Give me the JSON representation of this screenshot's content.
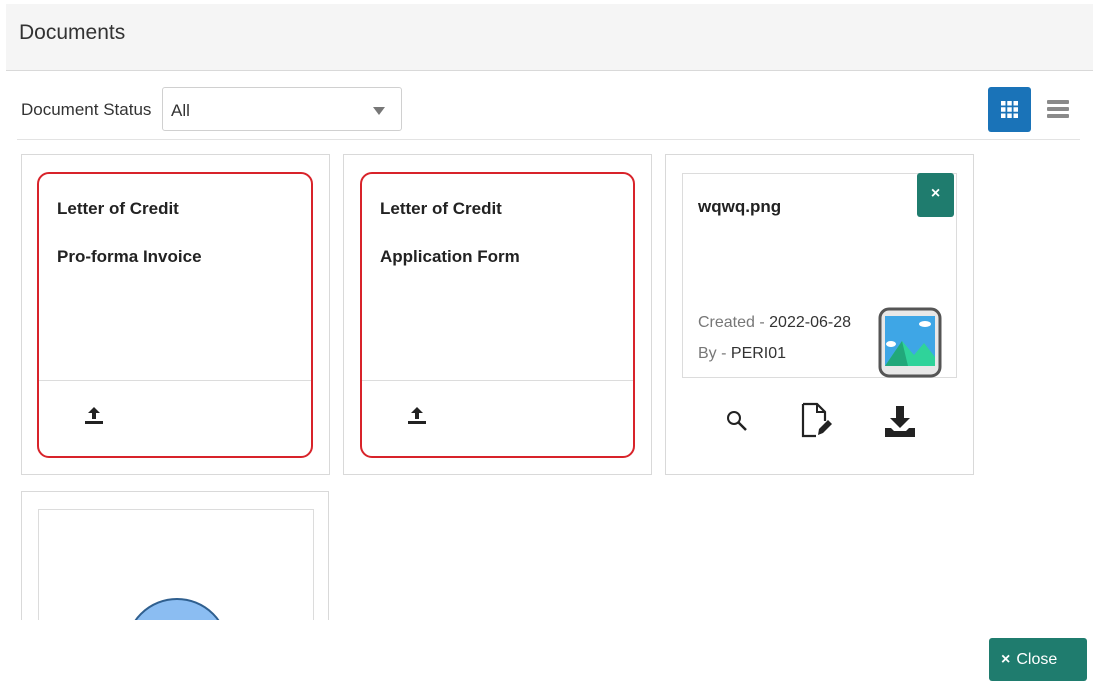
{
  "header": {
    "title": "Documents"
  },
  "filter": {
    "label": "Document Status",
    "value": "All"
  },
  "view_toggle": {
    "active": "grid",
    "accent_color": "#1a73b8"
  },
  "cards": [
    {
      "line1": "Letter of Credit",
      "line2": "Pro-forma Invoice",
      "status": "required",
      "border_color": "#d8232a"
    },
    {
      "line1": "Letter of Credit",
      "line2": "Application Form",
      "status": "required",
      "border_color": "#d8232a"
    }
  ],
  "file_card": {
    "file_name": "wqwq.png",
    "remove_label": "×",
    "created_label": "Created - ",
    "created_date": "2022-06-28",
    "by_label": "By - ",
    "by_user": "PERI01",
    "actions": [
      "search-icon",
      "edit-document-icon",
      "download-icon"
    ]
  },
  "footer": {
    "close_icon": "×",
    "close_label": "Close",
    "button_color": "#1f7c6e"
  }
}
